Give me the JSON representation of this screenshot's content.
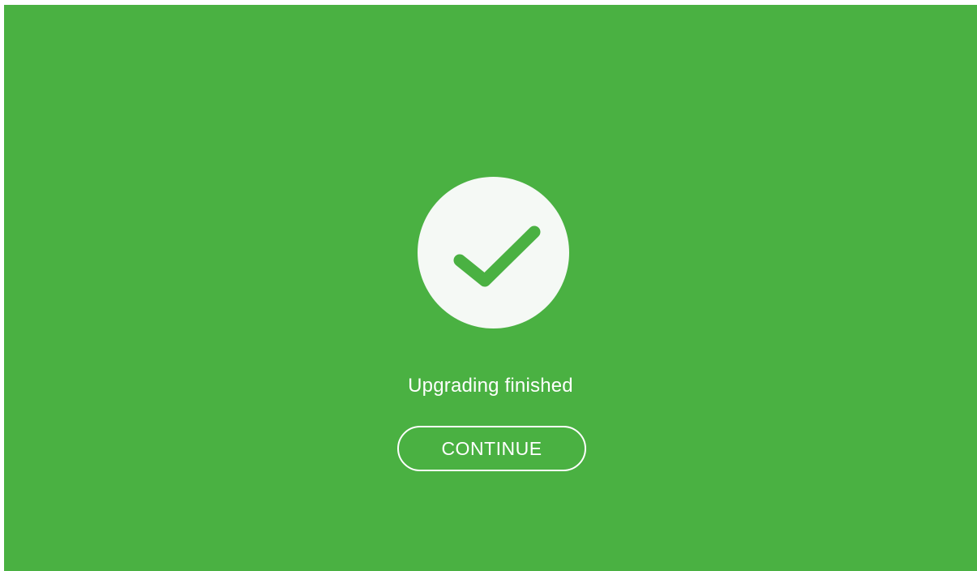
{
  "colors": {
    "background": "#4ab142",
    "circle": "#f5f9f5",
    "checkmark": "#4ab142",
    "text": "#ffffff"
  },
  "status": {
    "icon": "checkmark-icon",
    "message": "Upgrading finished"
  },
  "actions": {
    "continue_label": "CONTINUE"
  }
}
